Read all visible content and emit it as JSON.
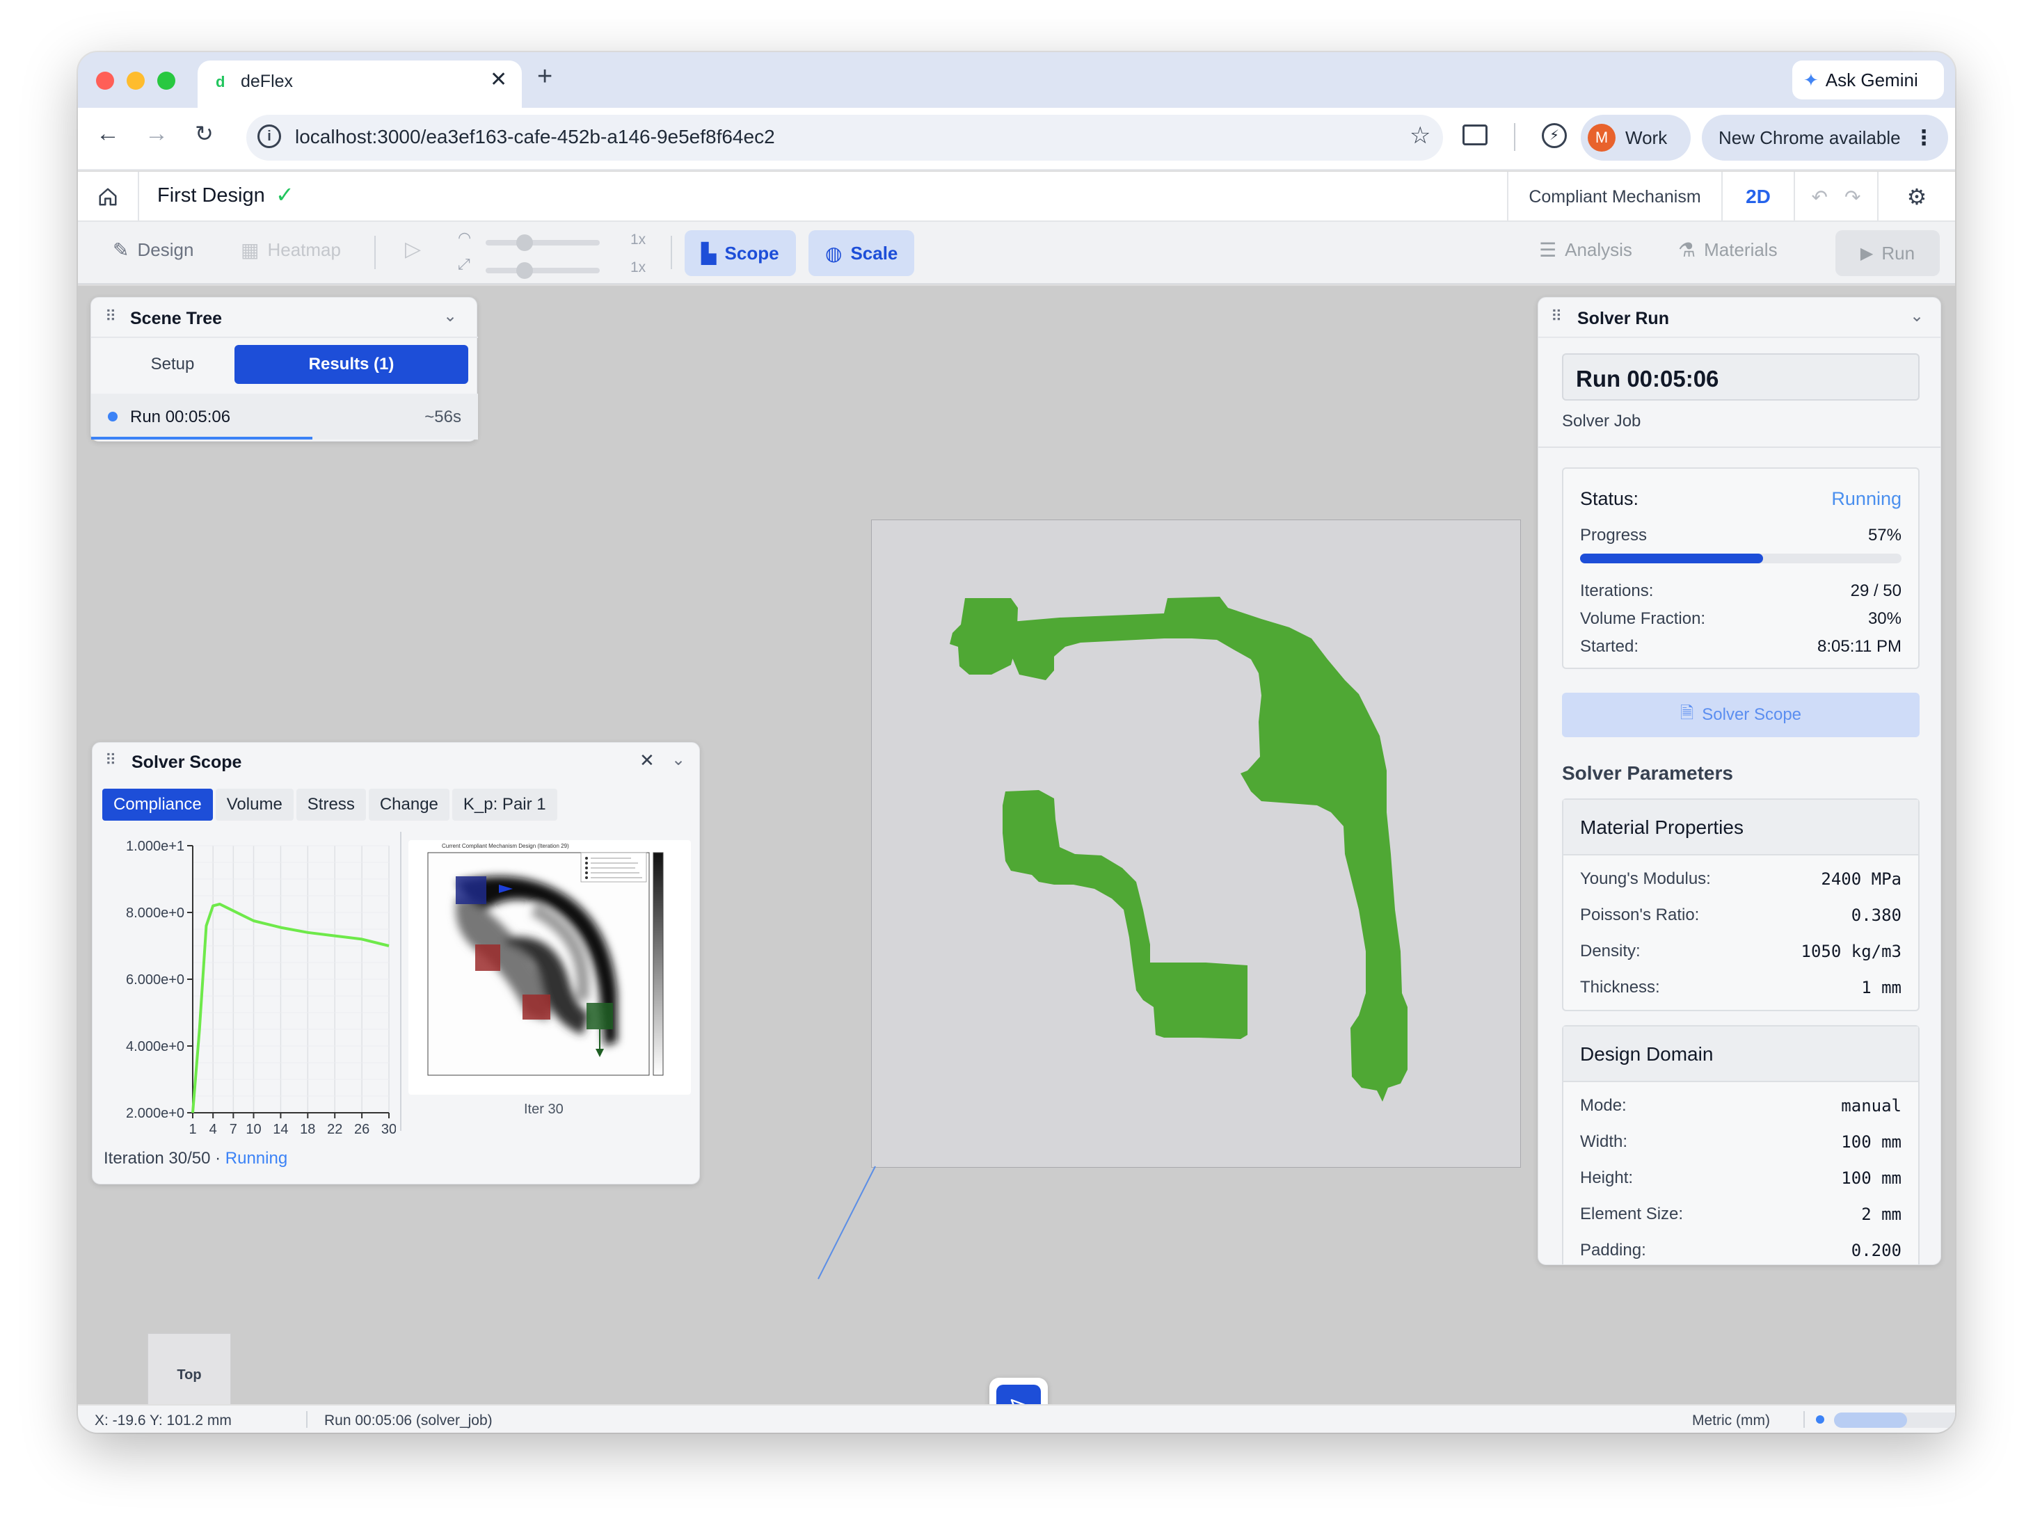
{
  "browser": {
    "tab_title": "deFlex",
    "tab_favicon_letter": "d",
    "url": "localhost:3000/ea3ef163-cafe-452b-a146-9e5ef8f64ec2",
    "ask_gemini": "Ask Gemini",
    "profile_initial": "M",
    "profile_label": "Work",
    "update_label": "New Chrome available"
  },
  "header": {
    "title": "First Design",
    "mechanism": "Compliant Mechanism",
    "mode": "2D"
  },
  "toolbar": {
    "design": "Design",
    "heatmap": "Heatmap",
    "speed_value_1": "1x",
    "speed_value_2": "1x",
    "scope": "Scope",
    "scale": "Scale",
    "analysis": "Analysis",
    "materials": "Materials",
    "run": "Run"
  },
  "scene_tree": {
    "title": "Scene Tree",
    "tab_setup": "Setup",
    "tab_results": "Results (1)",
    "run_label": "Run 00:05:06",
    "run_eta": "~56s"
  },
  "solver_scope": {
    "title": "Solver Scope",
    "tabs": [
      "Compliance",
      "Volume",
      "Stress",
      "Change",
      "K_p: Pair 1"
    ],
    "iter_caption": "Iter 30",
    "footer_prefix": "Iteration 30/50 · ",
    "footer_status": "Running",
    "thumb_title": "Current Compliant Mechanism Design (Iteration 29)"
  },
  "chart_data": {
    "type": "line",
    "series": [
      {
        "x": [
          1,
          2,
          3,
          4,
          5,
          6,
          8,
          10,
          14,
          18,
          22,
          26,
          30
        ],
        "values": [
          2.0,
          4.5,
          7.6,
          8.2,
          8.25,
          8.15,
          7.95,
          7.75,
          7.55,
          7.4,
          7.3,
          7.2,
          7.0
        ]
      }
    ],
    "y_ticks": [
      "1.000e+1",
      "8.000e+0",
      "6.000e+0",
      "4.000e+0",
      "2.000e+0"
    ],
    "x_ticks": [
      "1",
      "4",
      "7",
      "10",
      "14",
      "18",
      "22",
      "26",
      "30"
    ],
    "xlim": [
      1,
      30
    ],
    "ylim": [
      2,
      10
    ],
    "grid": true,
    "line_color": "#6ee94a"
  },
  "solver_run": {
    "title": "Solver Run",
    "run_name": "Run 00:05:06",
    "subtitle": "Solver Job",
    "status_label": "Status:",
    "status_value": "Running",
    "progress_label": "Progress",
    "progress_value": "57%",
    "progress_fraction": 0.57,
    "iterations_label": "Iterations:",
    "iterations_value": "29 / 50",
    "volfrac_label": "Volume Fraction:",
    "volfrac_value": "30%",
    "started_label": "Started:",
    "started_value": "8:05:11 PM",
    "scope_button": "Solver Scope",
    "params_title": "Solver Parameters",
    "material": {
      "title": "Material Properties",
      "rows": [
        {
          "label": "Young's Modulus:",
          "value": "2400 MPa"
        },
        {
          "label": "Poisson's Ratio:",
          "value": "0.380"
        },
        {
          "label": "Density:",
          "value": "1050 kg/m3"
        },
        {
          "label": "Thickness:",
          "value": "1 mm"
        }
      ]
    },
    "domain": {
      "title": "Design Domain",
      "rows": [
        {
          "label": "Mode:",
          "value": "manual"
        },
        {
          "label": "Width:",
          "value": "100 mm"
        },
        {
          "label": "Height:",
          "value": "100 mm"
        },
        {
          "label": "Element Size:",
          "value": "2 mm"
        },
        {
          "label": "Padding:",
          "value": "0.200"
        }
      ]
    }
  },
  "viewport": {
    "view_cube": "Top",
    "shape_color": "#4fa834"
  },
  "statusbar": {
    "coords": "X: -19.6 Y: 101.2 mm",
    "job": "Run 00:05:06 (solver_job)",
    "units": "Metric (mm)"
  }
}
